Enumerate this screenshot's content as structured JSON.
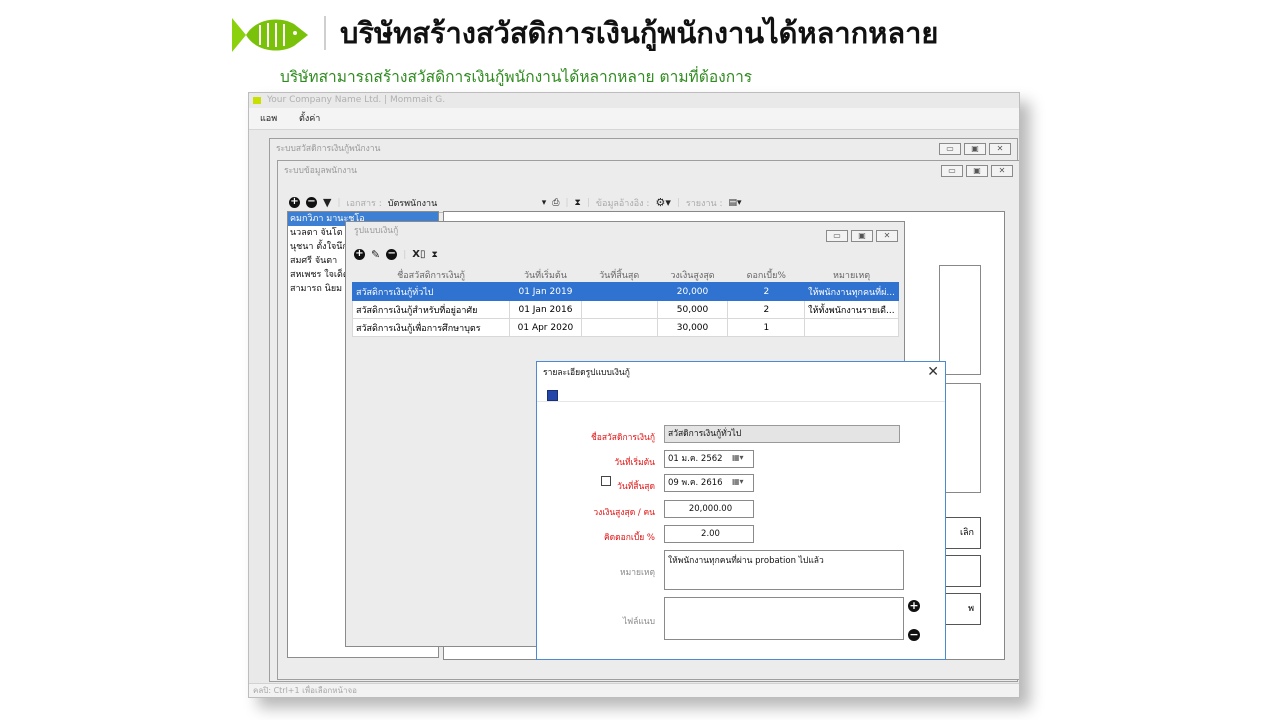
{
  "header": {
    "title": "บริษัทสร้างสวัสดิการเงินกู้พนักงานได้หลากหลาย",
    "subtitle": "บริษัทสามารถสร้างสวัสดิการเงินกู้พนักงานได้หลากหลาย ตามที่ต้องการ",
    "accent_color": "#7ac20a"
  },
  "app": {
    "title": "Your Company Name Ltd. | Mommait G.",
    "menu": [
      "แอพ",
      "ตั้งค่า"
    ],
    "status": "คลปิ: Ctrl+1 เพื่อเลือกหน้าจอ"
  },
  "win_outer": {
    "title": "ระบบสวัสดิการเงินกู้พนักงาน",
    "buttons": [
      "▭",
      "▣",
      "✕"
    ]
  },
  "win_inner": {
    "title": "ระบบข้อมูลพนักงาน",
    "toolbar": {
      "doc_label": "เอกสาร :",
      "doc_value": "บัตรพนักงาน",
      "ref_label": "ข้อมูลอ้างอิง :",
      "report_label": "รายงาน :"
    }
  },
  "employees": [
    "คมกวิภา มานะชูโอ",
    "นวลตา จันโต",
    "นุชนา ตั้งใจนึก",
    "สมศรี จันตา",
    "สหเพชร ใจเด็ด",
    "สามารถ นิยม"
  ],
  "side_buttons": [
    "เลิก",
    "",
    "พ"
  ],
  "template_window": {
    "title": "รูปแบบเงินกู้",
    "columns": [
      "ชื่อสวัสดิการเงินกู้",
      "วันที่เริ่มต้น",
      "วันที่สิ้นสุด",
      "วงเงินสูงสุด",
      "ดอกเบี้ย%",
      "หมายเหตุ"
    ],
    "rows": [
      [
        "สวัสดิการเงินกู้ทั่วไป",
        "01 Jan 2019",
        "",
        "20,000",
        "2",
        "ให้พนักงานทุกคนที่ผ่..."
      ],
      [
        "สวัสดิการเงินกู้สำหรับที่อยู่อาศัย",
        "01 Jan 2016",
        "",
        "50,000",
        "2",
        "ให้ทั้งพนักงานรายเดื..."
      ],
      [
        "สวัสดิการเงินกู้เพื่อการศึกษาบุตร",
        "01 Apr 2020",
        "",
        "30,000",
        "1",
        ""
      ]
    ]
  },
  "detail_dialog": {
    "title": "รายละเอียดรูปแบบเงินกู้",
    "name_label": "ชื่อสวัสดิการเงินกู้",
    "name_value": "สวัสดิการเงินกู้ทั่วไป",
    "start_label": "วันที่เริ่มต้น",
    "start_value": "01 ม.ค.   2562",
    "end_label": "วันที่สิ้นสุด",
    "end_value": "09 พ.ค.   2616",
    "limit_label": "วงเงินสูงสุด / คน",
    "limit_value": "20,000.00",
    "interest_label": "คิดดอกเบี้ย %",
    "interest_value": "2.00",
    "note_label": "หมายเหตุ",
    "note_value": "ให้พนักงานทุกคนที่ผ่าน probation ไปแล้ว",
    "attach_label": "ไฟล์แนบ",
    "close_glyph": "✕"
  }
}
